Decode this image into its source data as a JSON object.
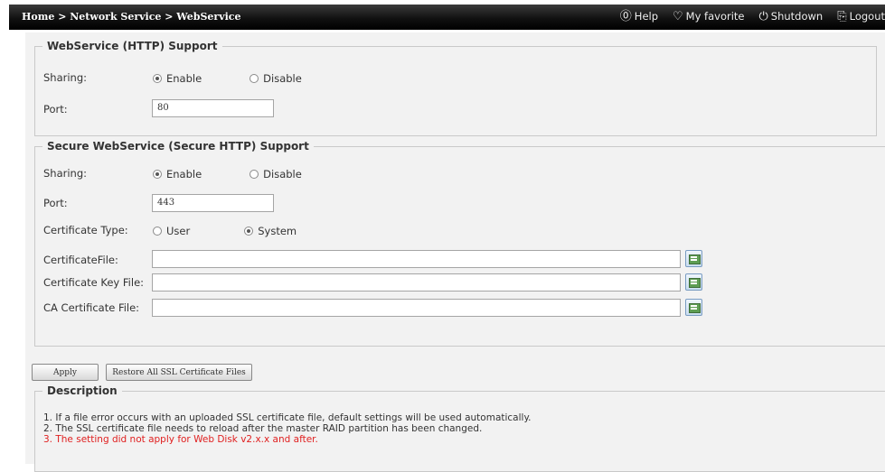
{
  "header": {
    "breadcrumb": "Home > Network Service > WebService",
    "links": [
      {
        "icon": "help-icon",
        "label": "Help"
      },
      {
        "icon": "favorite-icon",
        "label": "My favorite"
      },
      {
        "icon": "power-icon",
        "label": "Shutdown"
      },
      {
        "icon": "logout-icon",
        "label": "Logout"
      }
    ]
  },
  "http": {
    "legend": "WebService (HTTP) Support",
    "sharing_label": "Sharing:",
    "enable_label": "Enable",
    "disable_label": "Disable",
    "sharing_selected": "Enable",
    "port_label": "Port:",
    "port_value": "80"
  },
  "https": {
    "legend": "Secure WebService (Secure HTTP) Support",
    "sharing_label": "Sharing:",
    "enable_label": "Enable",
    "disable_label": "Disable",
    "sharing_selected": "Enable",
    "port_label": "Port:",
    "port_value": "443",
    "cert_type_label": "Certificate Type:",
    "cert_user_label": "User",
    "cert_system_label": "System",
    "cert_type_selected": "System",
    "cert_file_label": "CertificateFile:",
    "cert_key_label": "Certificate Key File:",
    "ca_cert_label": "CA Certificate File:"
  },
  "actions": {
    "apply_label": "Apply",
    "restore_label": "Restore All SSL Certificate Files"
  },
  "description": {
    "legend": "Description",
    "lines": [
      "1. If a file error occurs with an uploaded SSL certificate file, default settings will be used automatically.",
      "2. The SSL certificate file needs to reload after the master RAID partition has been changed.",
      "3. The setting did not apply for Web Disk v2.x.x and after."
    ],
    "warning_color": "#e02020"
  }
}
